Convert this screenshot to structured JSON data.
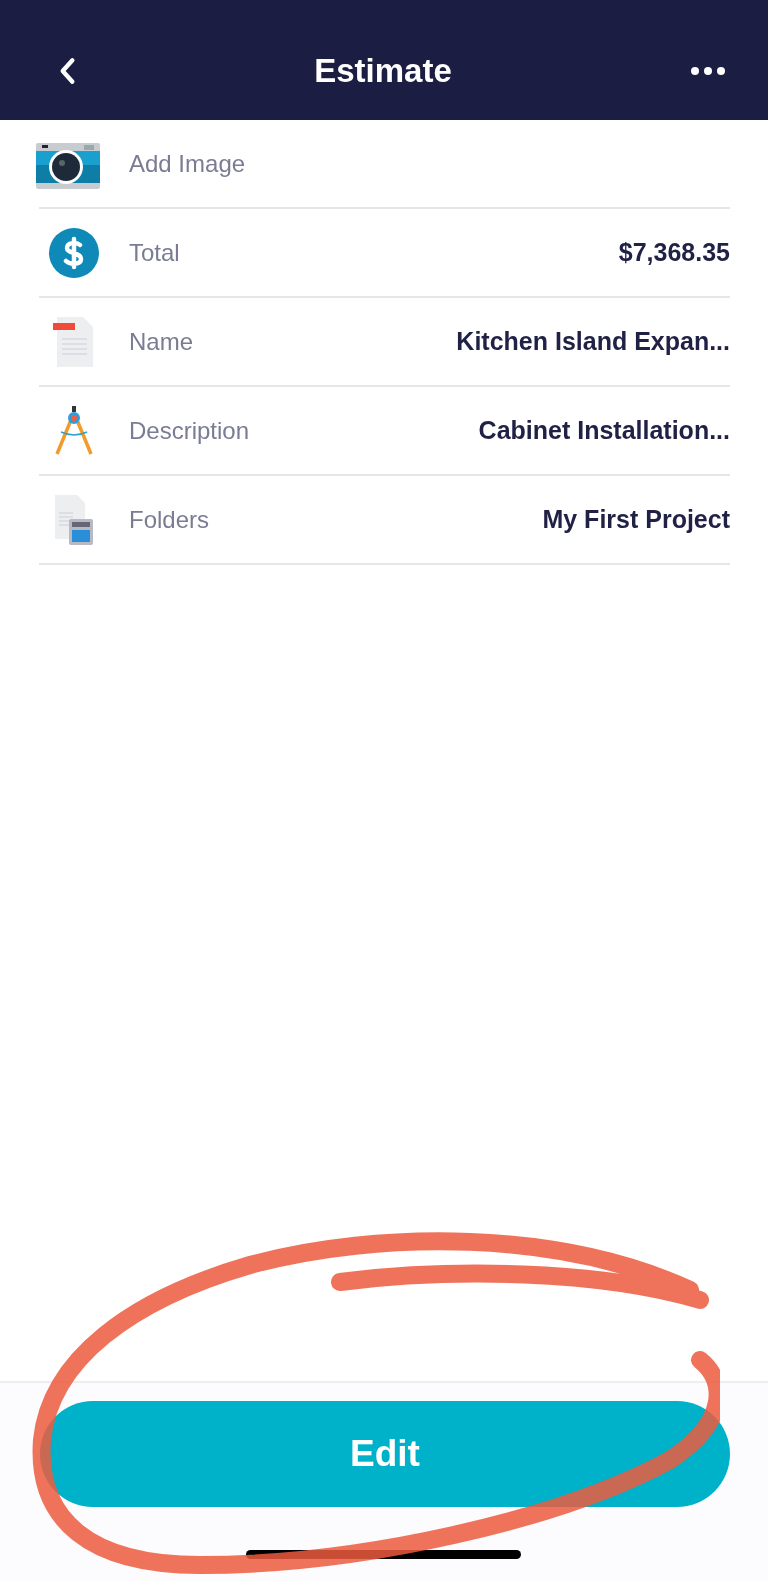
{
  "header": {
    "title": "Estimate"
  },
  "rows": [
    {
      "kind": "camera",
      "label": "Add Image"
    },
    {
      "kind": "dollar",
      "label": "Total",
      "value": "$7,368.35"
    },
    {
      "kind": "name-doc",
      "label": "Name",
      "value": "Kitchen Island Expan..."
    },
    {
      "kind": "compass",
      "label": "Description",
      "value": "Cabinet Installation..."
    },
    {
      "kind": "calculator-doc",
      "label": "Folders",
      "value": "My First Project"
    }
  ],
  "edit_button": "Edit"
}
